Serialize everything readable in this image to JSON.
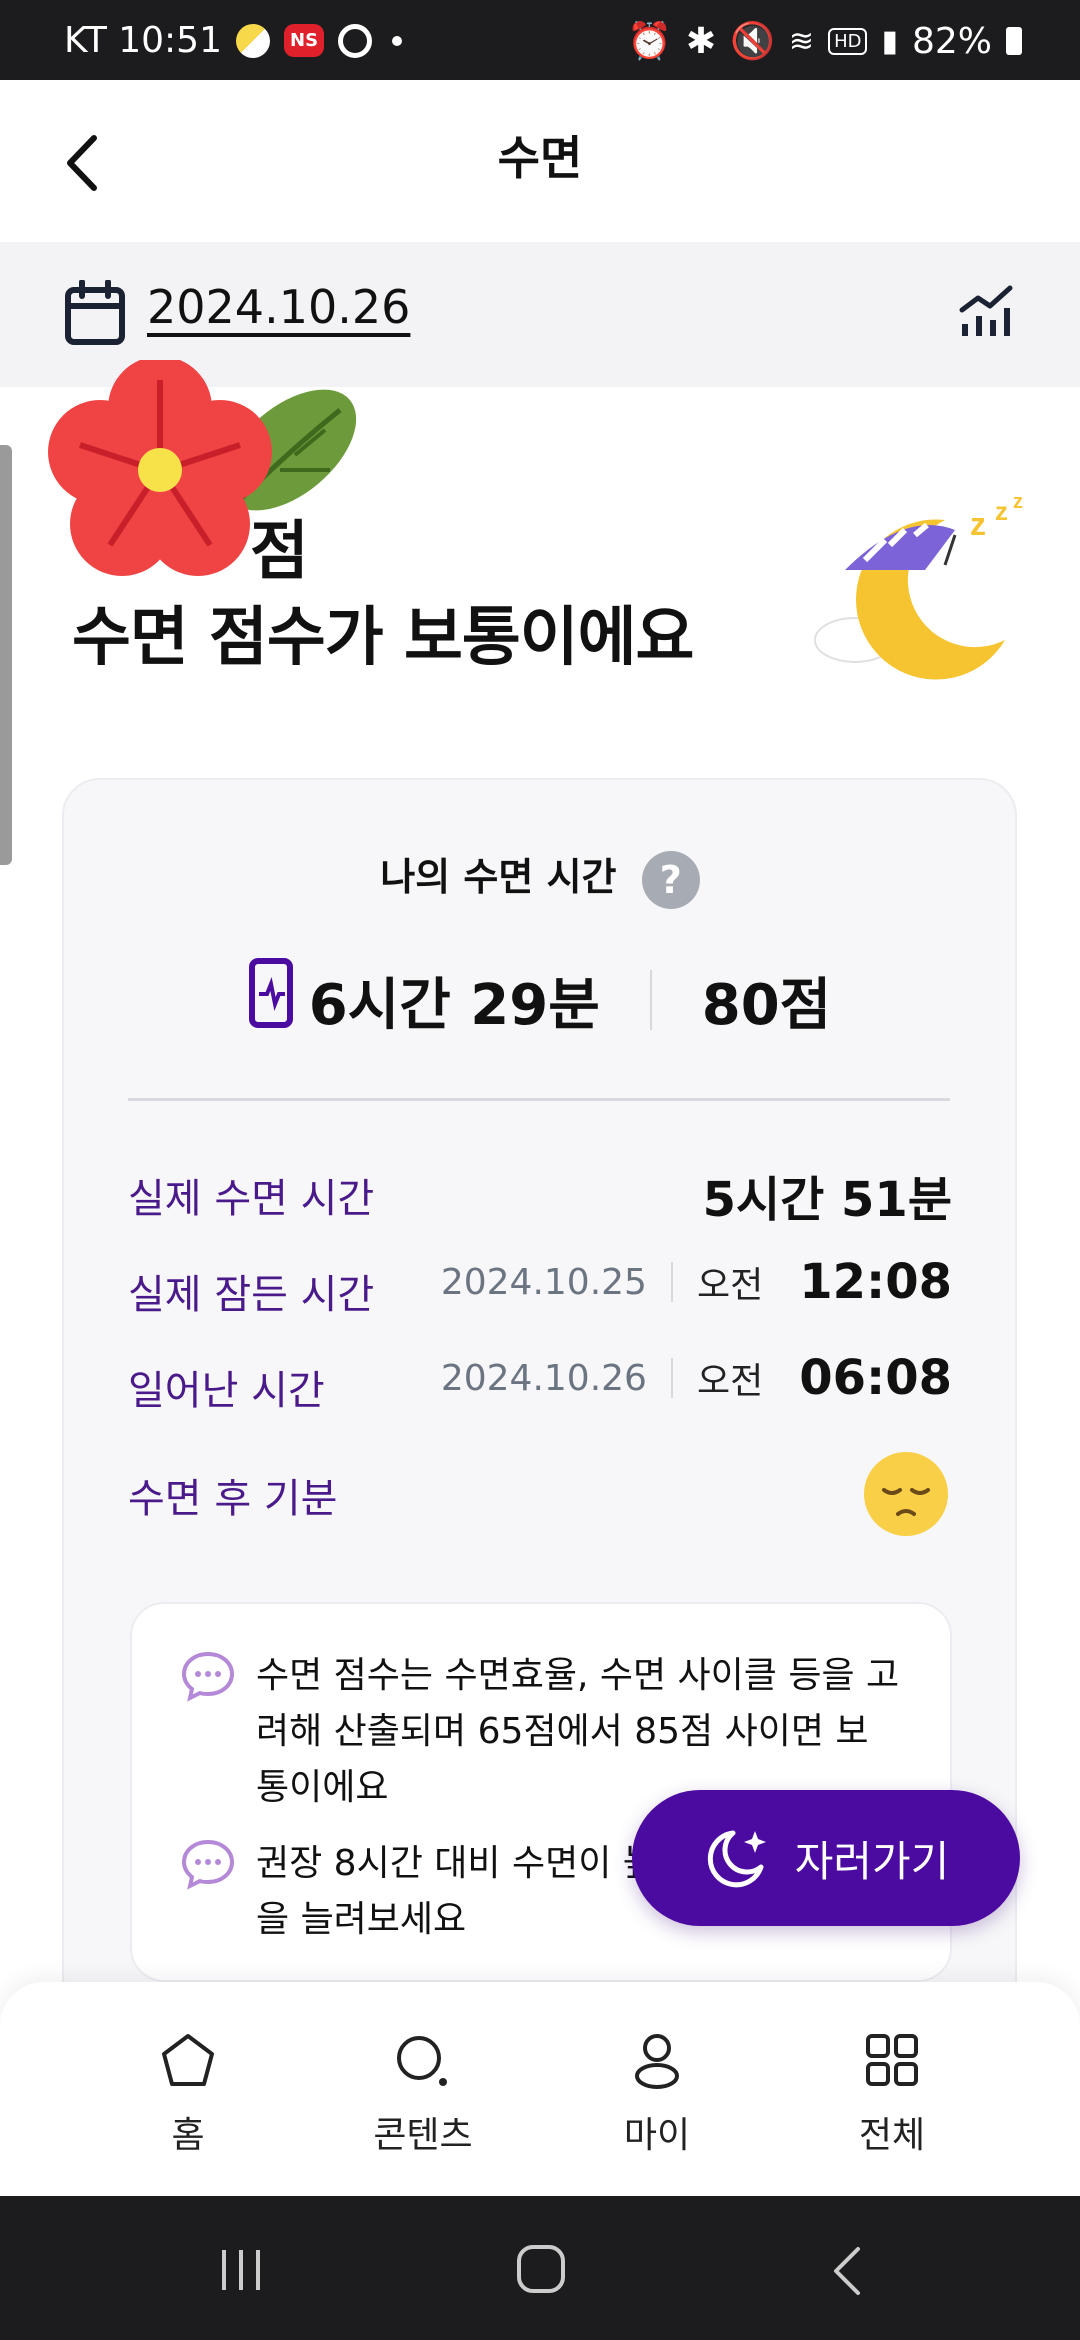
{
  "status_bar": {
    "carrier_time": "KT 10:51",
    "ns_badge": "NS",
    "battery": "82%",
    "hd": "HD"
  },
  "app_bar": {
    "title": "수면"
  },
  "date_bar": {
    "date": "2024.10.26"
  },
  "headline": {
    "score_text": "점",
    "message": "수면 점수가 보통이에요"
  },
  "card": {
    "title": "나의 수면 시간",
    "help": "?",
    "total_time": "6시간 29분",
    "score": "80점",
    "rows": [
      {
        "label": "실제 수면 시간",
        "value": "5시간 51분"
      },
      {
        "label": "실제 잠든 시간",
        "date": "2024.10.25",
        "ampm": "오전",
        "time": "12:08"
      },
      {
        "label": "일어난 시간",
        "date": "2024.10.26",
        "ampm": "오전",
        "time": "06:08"
      },
      {
        "label": "수면 후 기분",
        "mood_icon": "sleepy-face-icon"
      }
    ]
  },
  "tips": [
    "수면 점수는 수면효율, 수면 사이클 등을 고려해 산출되며 65점에서 85점 사이면 보통이에요",
    "권장 8시간 대비 수면이 높이려면 수면시간을 늘려보세요"
  ],
  "fab": {
    "label": "자러가기"
  },
  "bottom_nav": [
    {
      "label": "홈",
      "icon": "home-icon"
    },
    {
      "label": "콘텐츠",
      "icon": "search-icon"
    },
    {
      "label": "마이",
      "icon": "person-icon"
    },
    {
      "label": "전체",
      "icon": "grid-icon"
    }
  ],
  "colors": {
    "accent": "#4b0aa0",
    "label_purple": "#4a1a8a",
    "status_bar": "#1c1c1e"
  }
}
